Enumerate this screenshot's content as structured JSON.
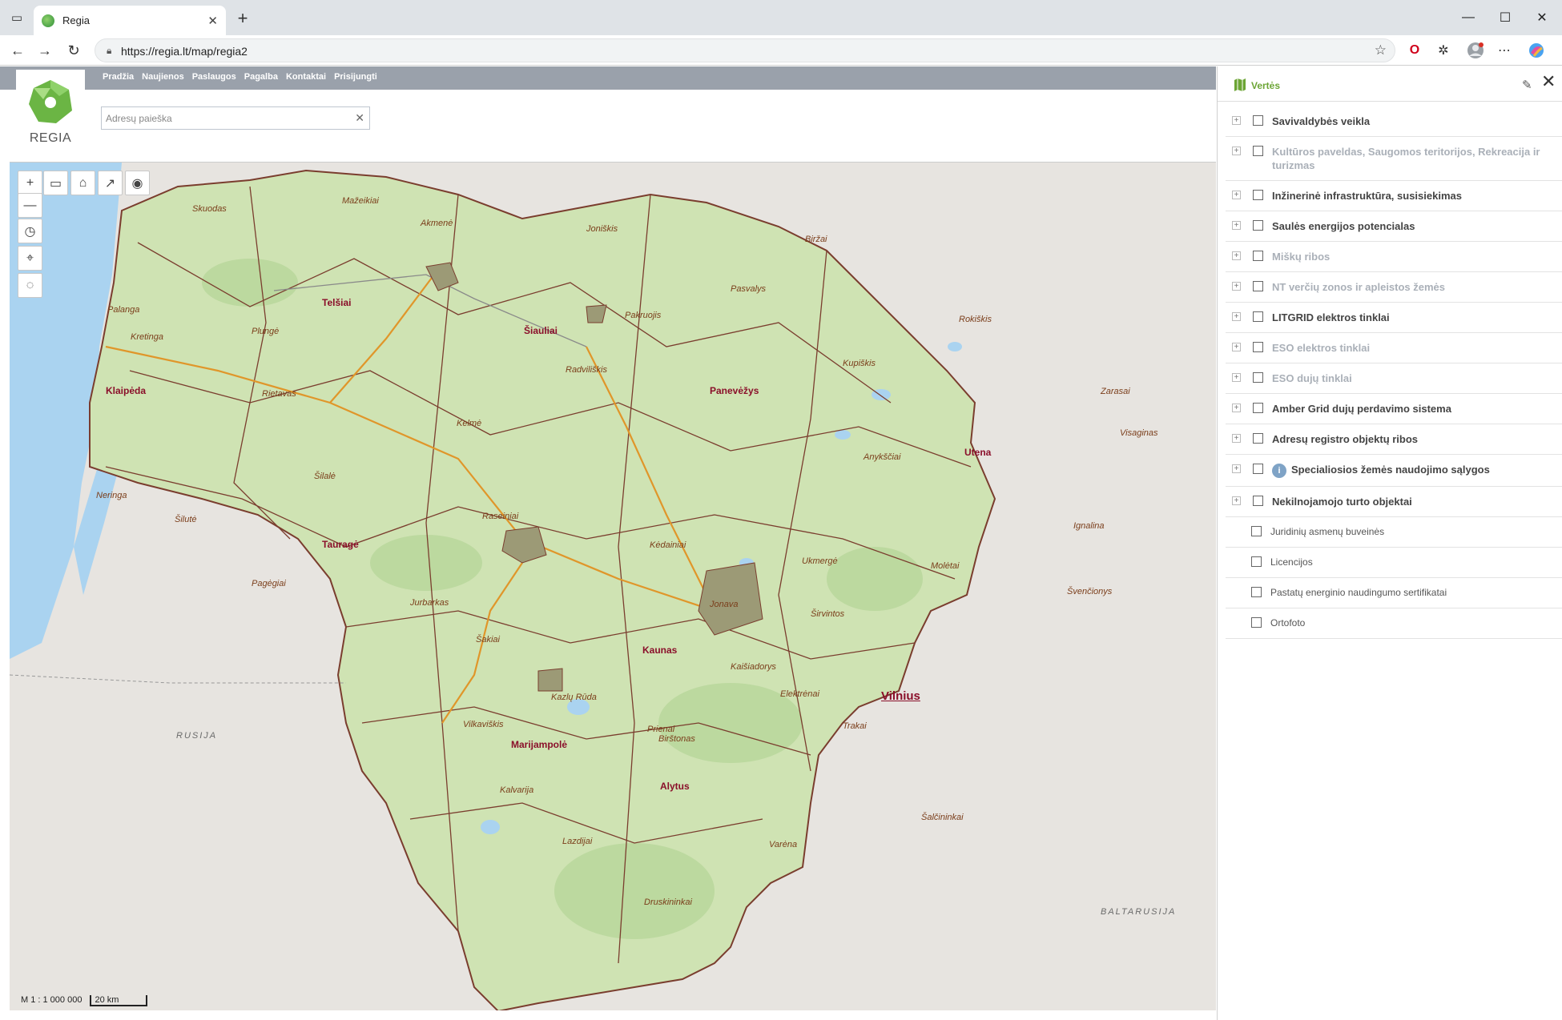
{
  "browser": {
    "tab_title": "Regia",
    "url": "https://regia.lt/map/regia2"
  },
  "site": {
    "logo_text": "REGIA",
    "menu": [
      "Pradžia",
      "Naujienos",
      "Paslaugos",
      "Pagalba",
      "Kontaktai",
      "Prisijungti"
    ],
    "search_placeholder": "Adresų paieška"
  },
  "map": {
    "scale_ratio": "M 1 : 1 000 000",
    "scale_bar": "20 km",
    "countries": [
      "RUSIJA",
      "BALTARUSIJA"
    ],
    "cities": {
      "skuodas": "Skuodas",
      "mazeikiai": "Mažeikiai",
      "akmene": "Akmenė",
      "joniskis": "Joniškis",
      "birzai": "Biržai",
      "pasvalys": "Pasvalys",
      "rokiskis": "Rokiškis",
      "palanga": "Palanga",
      "telsiai": "Telšiai",
      "plunge": "Plungė",
      "kretinga": "Kretinga",
      "siauliai": "Šiauliai",
      "pakruojis": "Pakruojis",
      "kupiskis": "Kupiškis",
      "radviliskis": "Radviliškis",
      "klaipeda": "Klaipėda",
      "panevezys": "Panevėžys",
      "zarasai": "Zarasai",
      "rietavas": "Rietavas",
      "visaginas": "Visaginas",
      "kelme": "Kelmė",
      "anyksciai": "Anykščiai",
      "utena": "Utena",
      "silale": "Šilalė",
      "neringa": "Neringa",
      "raseiniai": "Raseiniai",
      "silute": "Šilutė",
      "ignalina": "Ignalina",
      "kedainiai": "Kėdainiai",
      "taurage": "Tauragė",
      "ukmerge": "Ukmergė",
      "moletai": "Molėtai",
      "pagegiai": "Pagėgiai",
      "svencionys": "Švenčionys",
      "jurbarkas": "Jurbarkas",
      "jonava": "Jonava",
      "sirvintos": "Širvintos",
      "sakiai": "Šakiai",
      "kaunas": "Kaunas",
      "kaisiadorys": "Kaišiadorys",
      "vilnius": "Vilnius",
      "elektrenai": "Elektrėnai",
      "kazlu_ruda": "Kazlų Rūda",
      "vilkaviskis": "Vilkaviškis",
      "trakai": "Trakai",
      "prienai": "Prienai",
      "birstonas": "Birštonas",
      "marijampole": "Marijampolė",
      "kalvarija": "Kalvarija",
      "alytus": "Alytus",
      "salcininkai": "Šalčininkai",
      "lazdijai": "Lazdijai",
      "varena": "Varėna",
      "druskininkai": "Druskininkai"
    }
  },
  "panel": {
    "title": "Vertės",
    "layers": [
      {
        "label": "Savivaldybės veikla",
        "dim": false,
        "plain": false
      },
      {
        "label": "Kultūros paveldas, Saugomos teritorijos, Rekreacija ir turizmas",
        "dim": true,
        "plain": false
      },
      {
        "label": "Inžinerinė infrastruktūra, susisiekimas",
        "dim": false,
        "plain": false
      },
      {
        "label": "Saulės energijos potencialas",
        "dim": false,
        "plain": false
      },
      {
        "label": "Miškų ribos",
        "dim": true,
        "plain": false
      },
      {
        "label": "NT verčių zonos ir apleistos žemės",
        "dim": true,
        "plain": false
      },
      {
        "label": "LITGRID elektros tinklai",
        "dim": false,
        "plain": false
      },
      {
        "label": "ESO elektros tinklai",
        "dim": true,
        "plain": false
      },
      {
        "label": "ESO dujų tinklai",
        "dim": true,
        "plain": false
      },
      {
        "label": "Amber Grid dujų perdavimo sistema",
        "dim": false,
        "plain": false
      },
      {
        "label": "Adresų registro objektų ribos",
        "dim": false,
        "plain": false
      },
      {
        "label": "Specialiosios žemės naudojimo sąlygos",
        "dim": false,
        "plain": false,
        "info": true
      },
      {
        "label": "Nekilnojamojo turto objektai",
        "dim": false,
        "plain": false
      },
      {
        "label": "Juridinių asmenų buveinės",
        "dim": false,
        "plain": true
      },
      {
        "label": "Licencijos",
        "dim": false,
        "plain": true
      },
      {
        "label": "Pastatų energinio naudingumo sertifikatai",
        "dim": false,
        "plain": true
      },
      {
        "label": "Ortofoto",
        "dim": false,
        "plain": true
      }
    ]
  },
  "colors": {
    "accent": "#6ca535",
    "header_bar": "#9aa1ab",
    "map_land": "#cfe3b3",
    "map_water": "#aad3f0",
    "city_major": "#8a0f2a",
    "boundary": "#7a3d2e"
  }
}
